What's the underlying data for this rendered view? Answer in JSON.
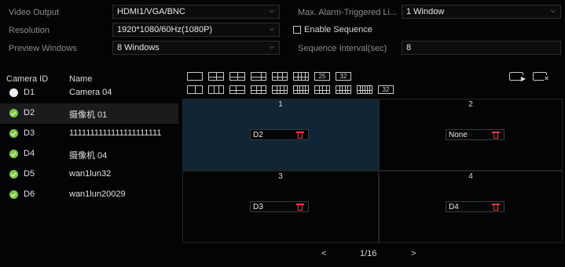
{
  "settings": {
    "video_output_label": "Video Output",
    "video_output_value": "HDMI1/VGA/BNC",
    "resolution_label": "Resolution",
    "resolution_value": "1920*1080/60Hz(1080P)",
    "preview_windows_label": "Preview Windows",
    "preview_windows_value": "8 Windows",
    "max_alarm_label": "Max. Alarm-Triggered Li...",
    "max_alarm_value": "1 Window",
    "enable_sequence_label": "Enable Sequence",
    "enable_sequence_checked": false,
    "sequence_interval_label": "Sequence Interval(sec)",
    "sequence_interval_value": "8"
  },
  "camera_list": {
    "col_id": "Camera ID",
    "col_name": "Name",
    "rows": [
      {
        "id": "D1",
        "name": "Camera 04",
        "status": "white",
        "selected": false
      },
      {
        "id": "D2",
        "name": "摄像机 01",
        "status": "green",
        "selected": true
      },
      {
        "id": "D3",
        "name": "1111111111111111111111",
        "status": "green",
        "selected": false
      },
      {
        "id": "D4",
        "name": "摄像机 04",
        "status": "green",
        "selected": false
      },
      {
        "id": "D5",
        "name": "wan1lun32",
        "status": "green",
        "selected": false
      },
      {
        "id": "D6",
        "name": "wan1lun20029",
        "status": "green",
        "selected": false
      }
    ]
  },
  "layout_icons": {
    "row1": [
      "layout-1",
      "layout-4",
      "layout-6",
      "layout-8",
      "layout-9",
      "layout-16",
      "25",
      "32"
    ],
    "row2": [
      "layout-2",
      "layout-3",
      "layout-5",
      "layout-7",
      "layout-10",
      "layout-12",
      "layout-13",
      "layout-20",
      "layout-24",
      "32"
    ]
  },
  "toolbar_icons": [
    "play-window-icon",
    "clear-window-icon"
  ],
  "windows": [
    {
      "number": "1",
      "camera": "D2",
      "active": true
    },
    {
      "number": "2",
      "camera": "None",
      "active": false
    },
    {
      "number": "3",
      "camera": "D3",
      "active": false
    },
    {
      "number": "4",
      "camera": "D4",
      "active": false
    }
  ],
  "pager": {
    "prev": "<",
    "page": "1/16",
    "next": ">"
  },
  "colors": {
    "accent_green": "#7cc843",
    "trash_red": "#e04040",
    "active_window": "#102636"
  }
}
